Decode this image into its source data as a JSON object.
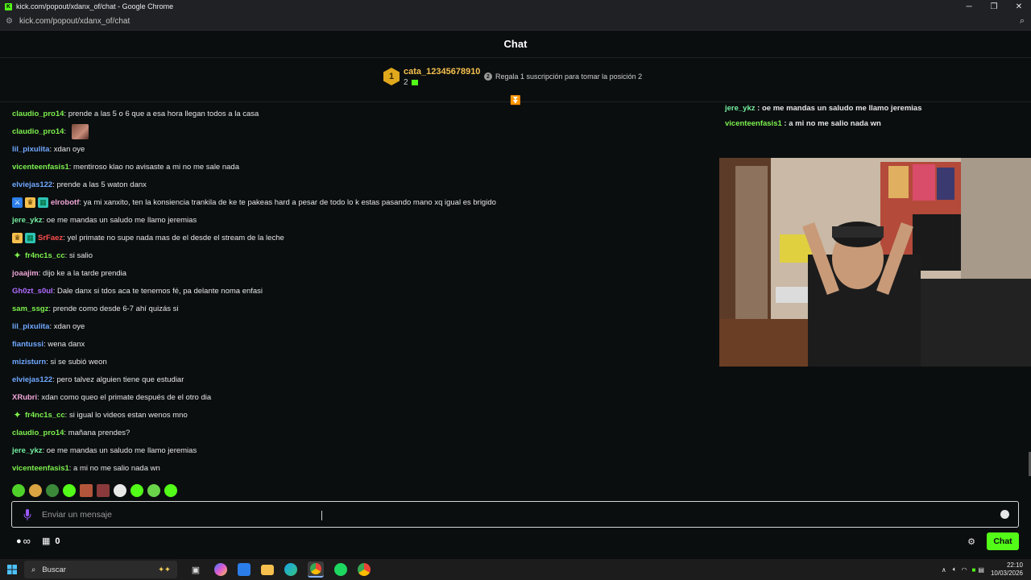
{
  "window": {
    "title": "kick.com/popout/xdanx_of/chat - Google Chrome",
    "url": "kick.com/popout/xdanx_of/chat",
    "controls": {
      "minimize": "─",
      "restore": "❐",
      "close": "✕"
    }
  },
  "header": {
    "title": "Chat"
  },
  "pinned": {
    "rank": "1",
    "username": "cata_12345678910",
    "count": "2",
    "promo_rank": "2",
    "promo": "Regala 1 suscripción para tomar la posición 2"
  },
  "messages": [
    {
      "user": "claudio_pro14",
      "color": "#7cf04e",
      "text": "prende a las 5 o 6 que a esa hora llegan todos a la casa"
    },
    {
      "user": "claudio_pro14",
      "color": "#7cf04e",
      "text": "",
      "emote": true
    },
    {
      "user": "lil_pixulita",
      "color": "#6fa8ff",
      "text": "xdan oye"
    },
    {
      "user": "vicenteenfasis1",
      "color": "#7cf04e",
      "text": "mentiroso klao no avisaste a mi no me sale nada"
    },
    {
      "user": "elviejas122",
      "color": "#6fa8ff",
      "text": "prende a las 5 waton danx"
    },
    {
      "user": "elrobotf",
      "color": "#f0a6d8",
      "text": "ya mi xanxito, ten la konsiencia trankila de ke te pakeas hard a pesar de todo lo k estas pasando mano xq igual es brigido",
      "badges": [
        "moderator",
        "crown",
        "sub"
      ]
    },
    {
      "user": "jere_ykz",
      "color": "#73f0a0",
      "text": "oe me mandas un saludo me llamo jeremias"
    },
    {
      "user": "SrFaez",
      "color": "#ff4d4d",
      "text": "yel primate no supe nada mas de el desde el stream de la leche",
      "badges": [
        "crown",
        "sub"
      ]
    },
    {
      "user": "fr4nc1s_cc",
      "color": "#7cf04e",
      "text": "si salio",
      "badges": [
        "spark"
      ]
    },
    {
      "user": "joaajim",
      "color": "#f0a6d8",
      "text": "dijo ke a la tarde prendia"
    },
    {
      "user": "Gh0zt_s0ul",
      "color": "#b06cff",
      "text": "Dale danx si tdos aca te tenemos fé, pa delante noma enfasi"
    },
    {
      "user": "sam_ssgz",
      "color": "#7cf04e",
      "text": "prende como desde 6-7 ahí quizás si"
    },
    {
      "user": "lil_pixulita",
      "color": "#6fa8ff",
      "text": "xdan oye"
    },
    {
      "user": "fiantussi",
      "color": "#6fa8ff",
      "text": "wena danx"
    },
    {
      "user": "mizisturn",
      "color": "#6fa8ff",
      "text": "si se subió weon"
    },
    {
      "user": "elviejas122",
      "color": "#6fa8ff",
      "text": "pero talvez alguien tiene que estudiar"
    },
    {
      "user": "XRubri",
      "color": "#f0a6d8",
      "text": "xdan como queo el primate después de el otro dia"
    },
    {
      "user": "fr4nc1s_cc",
      "color": "#7cf04e",
      "text": "si igual lo videos estan wenos mno",
      "badges": [
        "spark"
      ]
    },
    {
      "user": "claudio_pro14",
      "color": "#7cf04e",
      "text": "mañana prendes?"
    },
    {
      "user": "jere_ykz",
      "color": "#73f0a0",
      "text": "oe me mandas un saludo me llamo jeremias"
    },
    {
      "user": "vicenteenfasis1",
      "color": "#7cf04e",
      "text": "a mi no me salio nada wn"
    }
  ],
  "overlay_messages": [
    {
      "user": "jere_ykz",
      "color": "#73f0a0",
      "text": "oe me mandas un saludo me llamo jeremias"
    },
    {
      "user": "vicenteenfasis1",
      "color": "#7cf04e",
      "text": "a mi no me salio nada wn"
    }
  ],
  "input": {
    "placeholder": "Enviar un mensaje"
  },
  "footer": {
    "points": "0",
    "send_label": "Chat"
  },
  "taskbar": {
    "search_placeholder": "Buscar",
    "time": "22:10",
    "date": "10/03/2026"
  },
  "colors": {
    "accent": "#53fc18",
    "background": "#0b0e0f",
    "gold": "#f5c04e"
  }
}
